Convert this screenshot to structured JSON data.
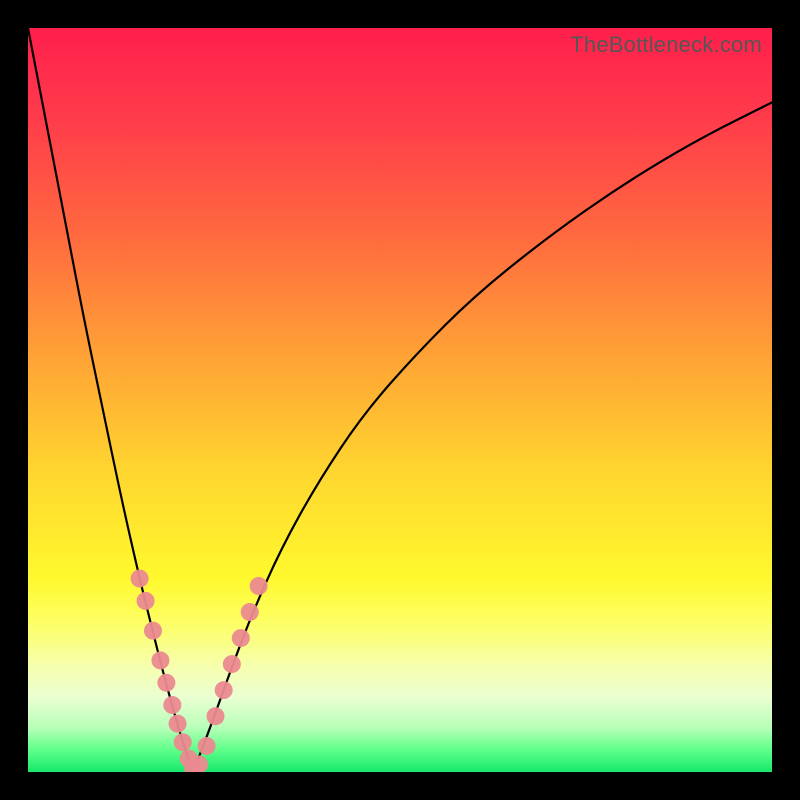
{
  "watermark": "TheBottleneck.com",
  "chart_data": {
    "type": "line",
    "title": "",
    "xlabel": "",
    "ylabel": "",
    "xlim": [
      0,
      1
    ],
    "ylim": [
      0,
      1
    ],
    "description": "Bottleneck curve: V-shaped plot where y represents bottleneck severity (0 = no bottleneck at bottom green band, 1 = severe at top red band). Minimum (optimal balance) occurs near x ≈ 0.22. Pink marker beads highlight the near-optimal region on both branches.",
    "series": [
      {
        "name": "left-branch",
        "x": [
          0.0,
          0.025,
          0.05,
          0.075,
          0.1,
          0.125,
          0.15,
          0.165,
          0.18,
          0.195,
          0.205,
          0.215,
          0.222
        ],
        "y": [
          1.0,
          0.87,
          0.74,
          0.61,
          0.49,
          0.37,
          0.26,
          0.2,
          0.14,
          0.085,
          0.05,
          0.02,
          0.0
        ]
      },
      {
        "name": "right-branch",
        "x": [
          0.222,
          0.245,
          0.27,
          0.3,
          0.34,
          0.39,
          0.45,
          0.52,
          0.6,
          0.7,
          0.8,
          0.9,
          1.0
        ],
        "y": [
          0.0,
          0.06,
          0.13,
          0.21,
          0.3,
          0.39,
          0.48,
          0.56,
          0.64,
          0.72,
          0.79,
          0.85,
          0.9
        ]
      }
    ],
    "markers": {
      "name": "optimal-region-beads",
      "color": "#eb8a90",
      "points": [
        {
          "x": 0.15,
          "y": 0.26
        },
        {
          "x": 0.158,
          "y": 0.23
        },
        {
          "x": 0.168,
          "y": 0.19
        },
        {
          "x": 0.178,
          "y": 0.15
        },
        {
          "x": 0.186,
          "y": 0.12
        },
        {
          "x": 0.194,
          "y": 0.09
        },
        {
          "x": 0.201,
          "y": 0.065
        },
        {
          "x": 0.208,
          "y": 0.04
        },
        {
          "x": 0.216,
          "y": 0.018
        },
        {
          "x": 0.222,
          "y": 0.005
        },
        {
          "x": 0.23,
          "y": 0.01
        },
        {
          "x": 0.24,
          "y": 0.035
        },
        {
          "x": 0.252,
          "y": 0.075
        },
        {
          "x": 0.263,
          "y": 0.11
        },
        {
          "x": 0.274,
          "y": 0.145
        },
        {
          "x": 0.286,
          "y": 0.18
        },
        {
          "x": 0.298,
          "y": 0.215
        },
        {
          "x": 0.31,
          "y": 0.25
        }
      ]
    },
    "background_gradient_stops": [
      {
        "offset": 0.0,
        "color": "#ff1f4c"
      },
      {
        "offset": 0.12,
        "color": "#ff3b4b"
      },
      {
        "offset": 0.28,
        "color": "#ff6a3f"
      },
      {
        "offset": 0.44,
        "color": "#ffa236"
      },
      {
        "offset": 0.6,
        "color": "#ffd72f"
      },
      {
        "offset": 0.74,
        "color": "#fff92e"
      },
      {
        "offset": 0.8,
        "color": "#fdff66"
      },
      {
        "offset": 0.86,
        "color": "#f6ffb0"
      },
      {
        "offset": 0.9,
        "color": "#eaffd2"
      },
      {
        "offset": 0.94,
        "color": "#b8ffb8"
      },
      {
        "offset": 0.97,
        "color": "#5fff8a"
      },
      {
        "offset": 1.0,
        "color": "#17e86b"
      }
    ]
  }
}
